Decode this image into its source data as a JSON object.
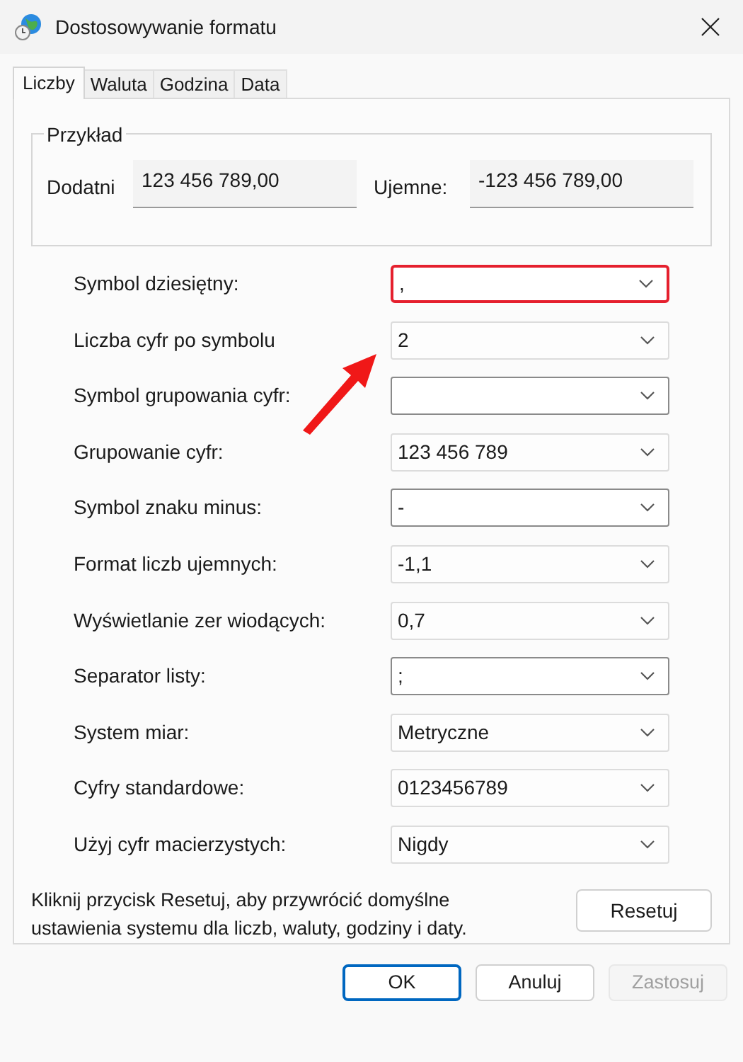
{
  "window": {
    "title": "Dostosowywanie formatu"
  },
  "tabs": [
    {
      "label": "Liczby",
      "selected": true
    },
    {
      "label": "Waluta",
      "selected": false
    },
    {
      "label": "Godzina",
      "selected": false
    },
    {
      "label": "Data",
      "selected": false
    }
  ],
  "example": {
    "title": "Przykład",
    "positive_label": "Dodatni",
    "positive_value": "123 456 789,00",
    "negative_label": "Ujemne:",
    "negative_value": "-123 456 789,00"
  },
  "settings": [
    {
      "label": "Symbol dziesiętny:",
      "value": ",",
      "kind": "editable",
      "highlighted": true
    },
    {
      "label": "Liczba cyfr po symbolu",
      "value": "2",
      "kind": "list",
      "highlighted": false
    },
    {
      "label": "Symbol grupowania cyfr:",
      "kind": "editable",
      "highlighted": false
    },
    {
      "label": "Grupowanie cyfr:",
      "value": "123 456 789",
      "kind": "list",
      "highlighted": false
    },
    {
      "label": "Symbol znaku minus:",
      "value": "-",
      "kind": "editable",
      "highlighted": false
    },
    {
      "label": "Format liczb ujemnych:",
      "value": "-1,1",
      "kind": "list",
      "highlighted": false
    },
    {
      "label": "Wyświetlanie zer wiodących:",
      "value": "0,7",
      "kind": "list",
      "highlighted": false
    },
    {
      "label": "Separator listy:",
      "value": ";",
      "kind": "editable",
      "highlighted": false
    },
    {
      "label": "System miar:",
      "value": "Metryczne",
      "kind": "list",
      "highlighted": false
    },
    {
      "label": "Cyfry standardowe:",
      "value": "0123456789",
      "kind": "list",
      "highlighted": false
    },
    {
      "label": "Użyj cyfr macierzystych:",
      "value": "Nigdy",
      "kind": "list",
      "highlighted": false
    }
  ],
  "reset_note": "Kliknij przycisk Resetuj, aby przywrócić domyślne ustawienia systemu dla liczb, waluty, godziny i daty.",
  "reset_button": "Resetuj",
  "buttons": [
    {
      "label": "OK",
      "default": true,
      "disabled": false
    },
    {
      "label": "Anuluj",
      "default": false,
      "disabled": false
    },
    {
      "label": "Zastosuj",
      "default": false,
      "disabled": true
    }
  ]
}
